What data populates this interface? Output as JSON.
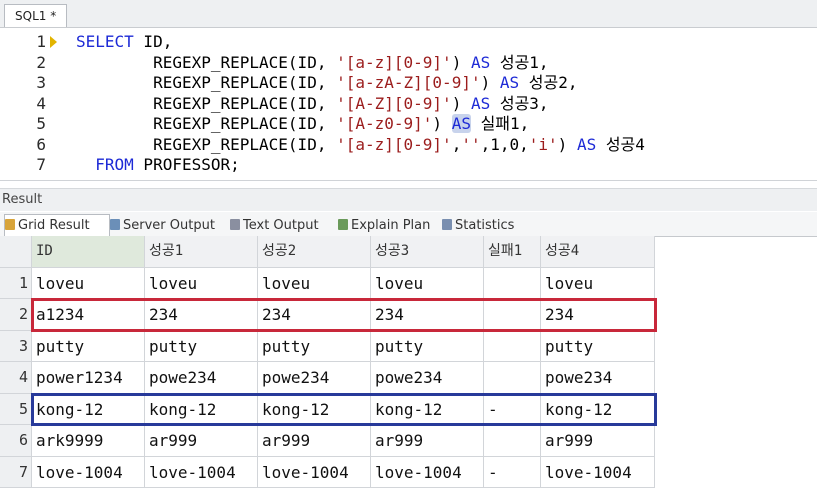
{
  "editor_tab": "SQL1 *",
  "sql_lines": [
    {
      "num": "1",
      "parts": [
        {
          "t": "SELECT",
          "c": "kw"
        },
        {
          "t": " ID,",
          "c": ""
        }
      ]
    },
    {
      "num": "2",
      "parts": [
        {
          "t": "        REGEXP_REPLACE(ID, ",
          "c": ""
        },
        {
          "t": "'[a-z][0-9]'",
          "c": "str"
        },
        {
          "t": ") ",
          "c": ""
        },
        {
          "t": "AS",
          "c": "kw"
        },
        {
          "t": " 성공1,",
          "c": ""
        }
      ]
    },
    {
      "num": "3",
      "parts": [
        {
          "t": "        REGEXP_REPLACE(ID, ",
          "c": ""
        },
        {
          "t": "'[a-zA-Z][0-9]'",
          "c": "str"
        },
        {
          "t": ") ",
          "c": ""
        },
        {
          "t": "AS",
          "c": "kw"
        },
        {
          "t": " 성공2,",
          "c": ""
        }
      ]
    },
    {
      "num": "4",
      "parts": [
        {
          "t": "        REGEXP_REPLACE(ID, ",
          "c": ""
        },
        {
          "t": "'[A-Z][0-9]'",
          "c": "str"
        },
        {
          "t": ") ",
          "c": ""
        },
        {
          "t": "AS",
          "c": "kw"
        },
        {
          "t": " 성공3,",
          "c": ""
        }
      ]
    },
    {
      "num": "5",
      "parts": [
        {
          "t": "        REGEXP_REPLACE(ID, ",
          "c": ""
        },
        {
          "t": "'[A-z0-9]'",
          "c": "str"
        },
        {
          "t": ") ",
          "c": ""
        },
        {
          "t": "AS",
          "c": "kw hl"
        },
        {
          "t": " 실패1,",
          "c": ""
        }
      ]
    },
    {
      "num": "6",
      "parts": [
        {
          "t": "        REGEXP_REPLACE(ID, ",
          "c": ""
        },
        {
          "t": "'[a-z][0-9]'",
          "c": "str"
        },
        {
          "t": ",",
          "c": ""
        },
        {
          "t": "''",
          "c": "str"
        },
        {
          "t": ",1,0,",
          "c": ""
        },
        {
          "t": "'i'",
          "c": "str"
        },
        {
          "t": ") ",
          "c": ""
        },
        {
          "t": "AS",
          "c": "kw"
        },
        {
          "t": " 성공4",
          "c": ""
        }
      ]
    },
    {
      "num": "7",
      "parts": [
        {
          "t": "  ",
          "c": ""
        },
        {
          "t": "FROM",
          "c": "kw"
        },
        {
          "t": " PROFESSOR;",
          "c": ""
        }
      ]
    }
  ],
  "result_label": "Result",
  "result_tabs": [
    {
      "label": "Grid Result",
      "icon": "grid-icon",
      "color": "#d8a43a",
      "active": true
    },
    {
      "label": "Server Output",
      "icon": "server-output-icon",
      "color": "#6b8fb8",
      "active": false
    },
    {
      "label": "Text Output",
      "icon": "text-output-icon",
      "color": "#8a8fa0",
      "active": false
    },
    {
      "label": "Explain Plan",
      "icon": "explain-plan-icon",
      "color": "#6a9a5a",
      "active": false
    },
    {
      "label": "Statistics",
      "icon": "statistics-icon",
      "color": "#7a8fb0",
      "active": false
    }
  ],
  "grid": {
    "columns": [
      "ID",
      "성공1",
      "성공2",
      "성공3",
      "실패1",
      "성공4"
    ],
    "rows": [
      {
        "num": "1",
        "cells": [
          "loveu",
          "loveu",
          "loveu",
          "loveu",
          "",
          "loveu"
        ]
      },
      {
        "num": "2",
        "cells": [
          "a1234",
          "234",
          "234",
          "234",
          "",
          "234"
        ]
      },
      {
        "num": "3",
        "cells": [
          "putty",
          "putty",
          "putty",
          "putty",
          "",
          "putty"
        ]
      },
      {
        "num": "4",
        "cells": [
          "power1234",
          "powe234",
          "powe234",
          "powe234",
          "",
          "powe234"
        ]
      },
      {
        "num": "5",
        "cells": [
          "kong-12",
          "kong-12",
          "kong-12",
          "kong-12",
          "-",
          "kong-12"
        ]
      },
      {
        "num": "6",
        "cells": [
          "ark9999",
          "ar999",
          "ar999",
          "ar999",
          "",
          "ar999"
        ]
      },
      {
        "num": "7",
        "cells": [
          "love-1004",
          "love-1004",
          "love-1004",
          "love-1004",
          "-",
          "love-1004"
        ]
      }
    ]
  },
  "highlights": [
    {
      "row": 1,
      "color": "#c8283a"
    },
    {
      "row": 4,
      "color": "#283a9a"
    }
  ],
  "colors": {
    "keyword": "#1d2ad6",
    "string": "#9b1c1c",
    "marker": "#e2b400"
  }
}
